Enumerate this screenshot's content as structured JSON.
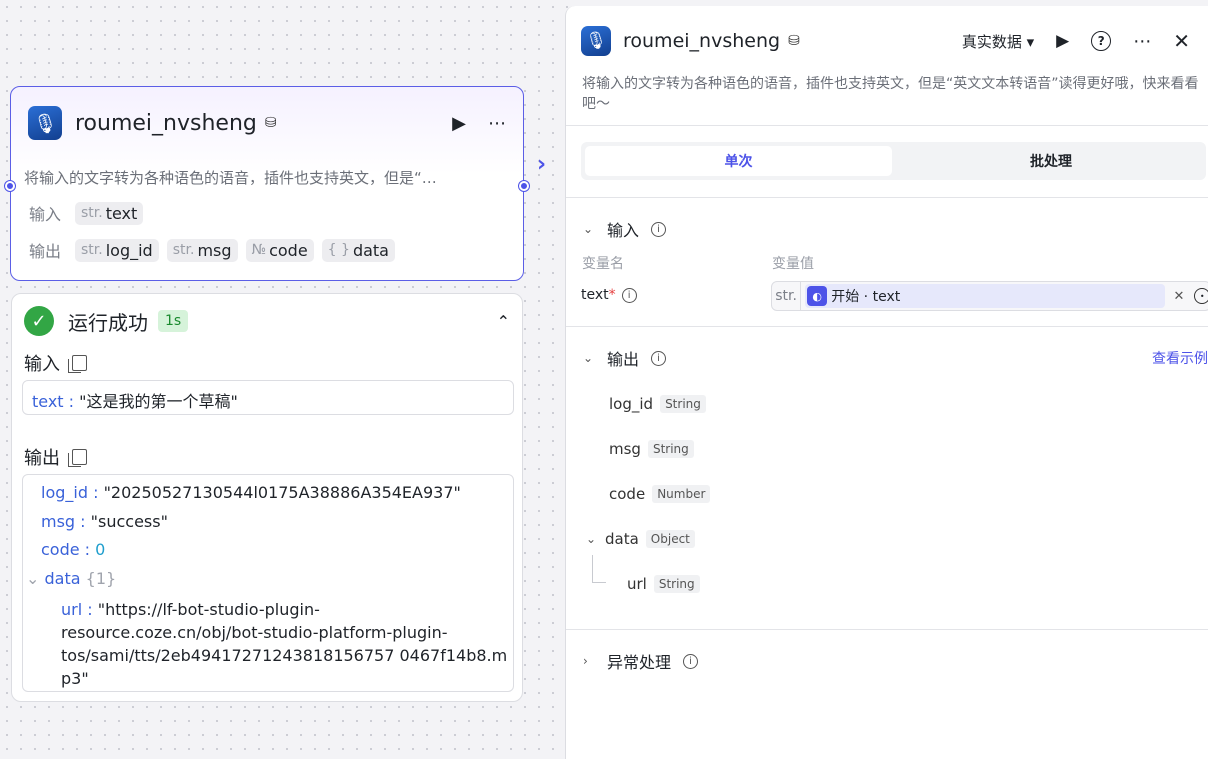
{
  "node": {
    "title": "roumei_nvsheng",
    "avatar_icon": "mic-avatar-icon",
    "description": "将输入的文字转为各种语色的语音，插件也支持英文，但是“…",
    "input_label": "输入",
    "output_label": "输出",
    "inputs": [
      {
        "type": "str.",
        "name": "text"
      }
    ],
    "outputs": [
      {
        "type": "str.",
        "name": "log_id"
      },
      {
        "type": "str.",
        "name": "msg"
      },
      {
        "type": "№",
        "name": "code"
      },
      {
        "type": "{ }",
        "name": "data"
      }
    ]
  },
  "run": {
    "status": "运行成功",
    "duration": "1s",
    "input_label": "输入",
    "output_label": "输出",
    "input_key": "text :",
    "input_value": "\"这是我的第一个草稿\"",
    "outputs": {
      "log_id_key": "log_id :",
      "log_id_value": "\"20250527130544l0175A38886A354EA937\"",
      "msg_key": "msg :",
      "msg_value": "\"success\"",
      "code_key": "code :",
      "code_value": "0",
      "data_key": "data",
      "data_count": "{1}",
      "url_key": "url :",
      "url_line1": "\"https://lf-bot-studio-plugin-",
      "url_line2": "resource.coze.cn/obj/bot-studio-platform-plugin-",
      "url_line3": "tos/sami/tts/2eb49417271243818156757 0467f14b8.m",
      "url_line4": "p3\""
    }
  },
  "side": {
    "title": "roumei_nvsheng",
    "data_mode": "真实数据 ▾",
    "description": "将输入的文字转为各种语色的语音，插件也支持英文，但是“英文文本转语音”读得更好哦，快来看看吧～",
    "tabs": {
      "single": "单次",
      "batch": "批处理"
    },
    "input_section": "输入",
    "col_var_name": "变量名",
    "col_var_value": "变量值",
    "var_name": "text",
    "ref_type": "str.",
    "ref_value": "开始 · text",
    "output_section": "输出",
    "view_example": "查看示例",
    "outputs": [
      {
        "name": "log_id",
        "type": "String"
      },
      {
        "name": "msg",
        "type": "String"
      },
      {
        "name": "code",
        "type": "Number"
      },
      {
        "name": "data",
        "type": "Object"
      },
      {
        "name": "url",
        "type": "String"
      }
    ],
    "exception_section": "异常处理"
  },
  "colors": {
    "accent": "#4d53e8",
    "success": "#32a645"
  }
}
